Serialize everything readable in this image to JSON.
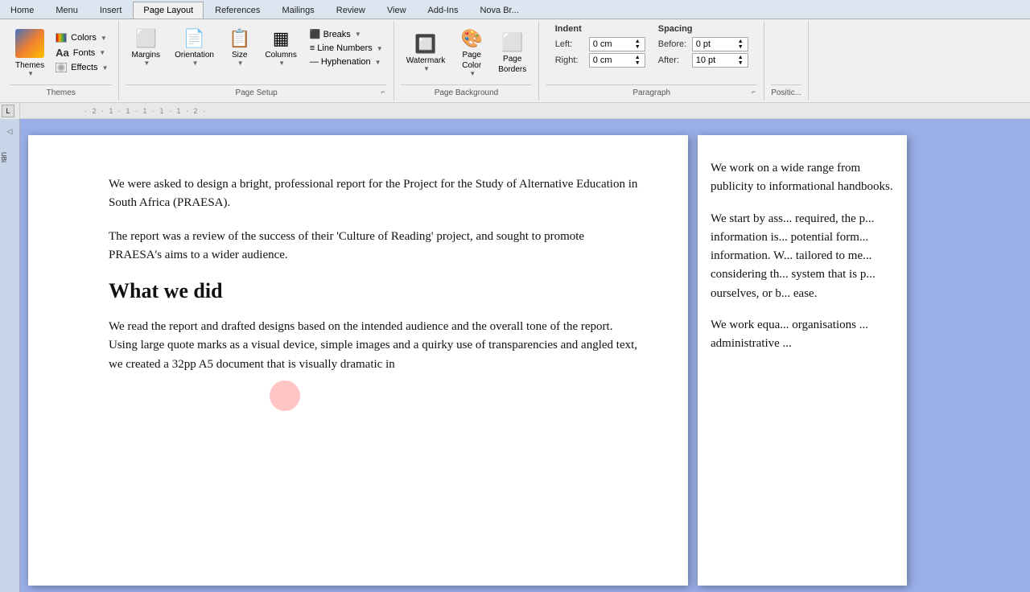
{
  "ribbon": {
    "tabs": [
      "Home",
      "Menu",
      "Insert",
      "Page Layout",
      "References",
      "Mailings",
      "Review",
      "View",
      "Add-Ins",
      "Nova Br..."
    ],
    "active_tab": "Page Layout",
    "groups": {
      "themes": {
        "label": "Themes",
        "themes_btn": "Themes",
        "colors_btn": "Colors",
        "fonts_btn": "Fonts",
        "effects_btn": "Effects"
      },
      "page_setup": {
        "label": "Page Setup",
        "buttons": [
          "Margins",
          "Orientation",
          "Size",
          "Columns",
          "Breaks",
          "Line Numbers",
          "Hyphenation"
        ],
        "expand_icon": "⌐"
      },
      "page_background": {
        "label": "Page Background",
        "buttons": [
          "Watermark",
          "Page Color",
          "Page Borders"
        ]
      },
      "paragraph": {
        "label": "Paragraph",
        "indent": {
          "label": "Indent",
          "left_label": "Left:",
          "left_value": "0 cm",
          "right_label": "Right:",
          "right_value": "0 cm"
        },
        "spacing": {
          "label": "Spacing",
          "before_label": "Before:",
          "before_value": "0 pt",
          "after_label": "After:",
          "after_value": "10 pt"
        },
        "expand_icon": "⌐"
      },
      "position": {
        "label": "Positic..."
      }
    }
  },
  "ruler": {
    "numbers": "· 2 · 1 · 1 · 1 · 1 · 1 · 2 ·"
  },
  "document": {
    "page1": {
      "paragraphs": [
        "We were asked to design a bright, professional report for the Project for the Study of Alternative Education in South Africa (PRAESA).",
        "The report was a review of the success of their 'Culture of Reading' project, and sought to promote PRAESA's aims to a wider audience.",
        "What we did",
        "We read the report and drafted designs based on the intended audience and the overall tone of the report. Using large quote marks as a visual device, simple images and a quirky use of transparencies and angled text, we created a 32pp A5 document that is visually dramatic in"
      ]
    },
    "page2": {
      "paragraphs": [
        "We work on a wide range from publicity to informational handbooks.",
        "We start by ass... required, the p... information is... potential form... information. W... tailored to me... considering th... system that is p... ourselves, or b... ease.",
        "We work equa... organisations ... administrative ..."
      ]
    }
  }
}
